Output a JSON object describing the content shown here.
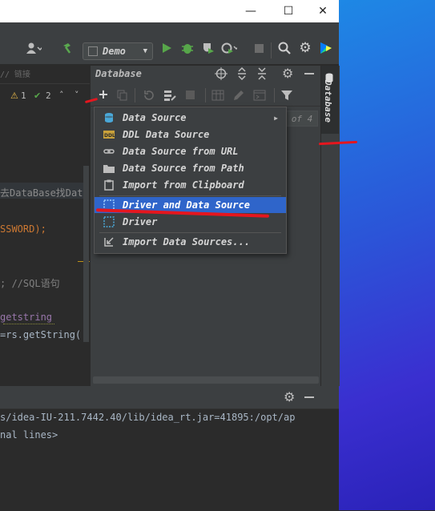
{
  "window": {
    "controls": [
      "—",
      "☐",
      "✕"
    ]
  },
  "toolbar": {
    "run_config": "Demo",
    "icons": [
      "user-icon",
      "hammer-icon",
      "run-icon",
      "debug-icon",
      "coverage-icon",
      "profile-icon",
      "stop-icon",
      "search-icon",
      "gear-icon",
      "toolbox-icon"
    ]
  },
  "editor": {
    "warnings": "1",
    "checks": "2",
    "lines": [
      "去DataBase找Dat",
      "SSWORD);",
      "; //SQL语句",
      "getstring",
      "=rs.getString("
    ],
    "top_hint": "// 链接"
  },
  "database_panel": {
    "title": "Database",
    "page_indicator": "of 4",
    "tab_label": "Database"
  },
  "menu": {
    "items": [
      {
        "label": "Data Source",
        "icon": "database-icon",
        "submenu": true
      },
      {
        "label": "DDL Data Source",
        "icon": "ddl-icon"
      },
      {
        "label": "Data Source from URL",
        "icon": "url-icon"
      },
      {
        "label": "Data Source from Path",
        "icon": "folder-icon"
      },
      {
        "label": "Import from Clipboard",
        "icon": "clipboard-icon"
      },
      {
        "label": "Driver and Data Source",
        "icon": "driver-datasource-icon",
        "selected": true
      },
      {
        "label": "Driver",
        "icon": "driver-icon"
      },
      {
        "label": "Import Data Sources...",
        "icon": "import-icon"
      }
    ]
  },
  "run_panel": {
    "line1": "s/idea-IU-211.7442.40/lib/idea_rt.jar=41895:/opt/ap",
    "line2": "nal lines>"
  },
  "colors": {
    "accent": "#2f65ca",
    "annotation": "#e5161e",
    "desktop": "#2b55d8"
  }
}
